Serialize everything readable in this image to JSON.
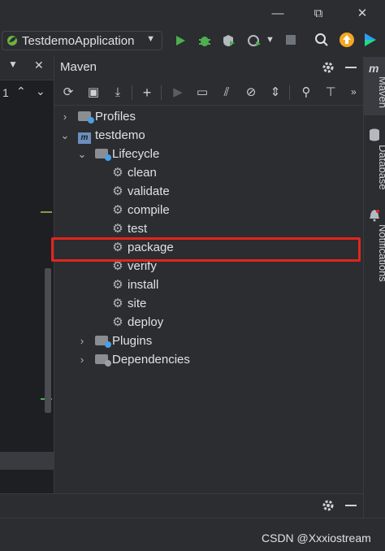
{
  "window": {
    "controls": {
      "minimize_icon": "—",
      "restore_icon": "⧉",
      "close_icon": "✕"
    }
  },
  "runbar": {
    "run_config": "TestdemoApplication"
  },
  "left_gutter": {
    "line_number": "1"
  },
  "maven": {
    "title": "Maven",
    "tree": {
      "profiles": "Profiles",
      "project": "testdemo",
      "lifecycle": "Lifecycle",
      "phases": [
        "clean",
        "validate",
        "compile",
        "test",
        "package",
        "verify",
        "install",
        "site",
        "deploy"
      ],
      "plugins": "Plugins",
      "dependencies": "Dependencies"
    },
    "highlighted_phase": "package"
  },
  "right_tabs": {
    "maven": "Maven",
    "database": "Database",
    "notifications": "Notifications"
  },
  "watermark": "CSDN @Xxxiostream",
  "colors": {
    "highlight_border": "#e0261f",
    "run_green": "#4caf50",
    "accent_orange": "#f5a623"
  }
}
